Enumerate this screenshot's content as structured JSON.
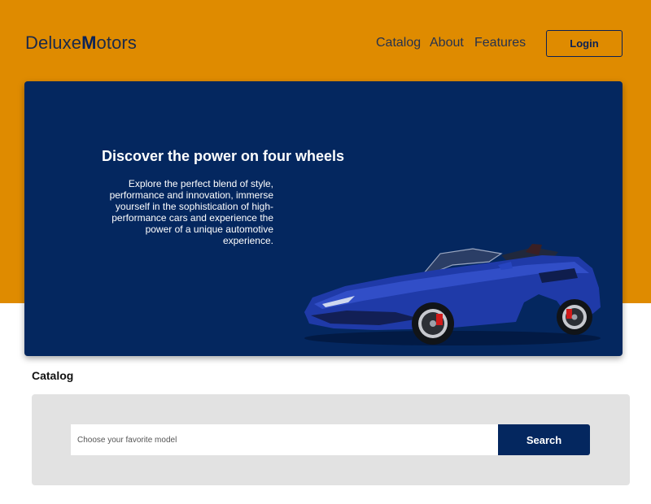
{
  "header": {
    "logo_part1": "Deluxe",
    "logo_part2": "M",
    "logo_part3": "otors",
    "nav": [
      "Catalog",
      "About",
      "Features"
    ],
    "login_label": "Login"
  },
  "hero": {
    "title": "Discover the power on four wheels",
    "text": "Explore the perfect blend of style, performance and innovation, immerse yourself in the sophistication of high-performance cars and experience the power of a unique automotive experience.",
    "image": "blue-convertible-sports-car"
  },
  "catalog": {
    "title": "Catalog",
    "search_placeholder": "Choose your favorite model",
    "search_label": "Search"
  },
  "colors": {
    "orange": "#df8b00",
    "navy": "#04275f",
    "panel": "#e2e2e2"
  }
}
